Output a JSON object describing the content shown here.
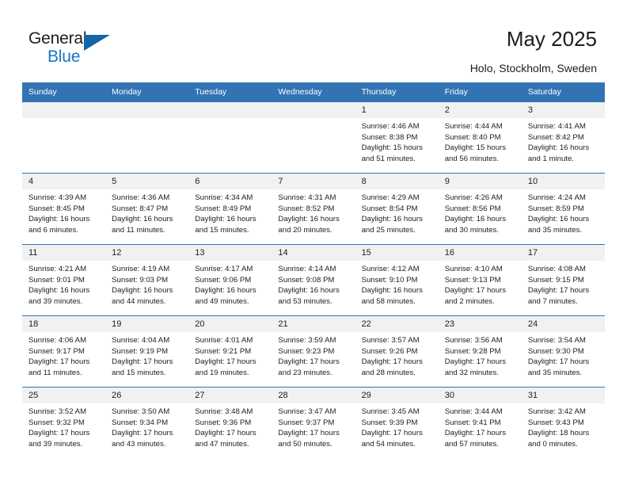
{
  "brand": {
    "name_top": "General",
    "name_bottom": "Blue",
    "accent_color": "#1876c8",
    "triangle_color": "#1464aa"
  },
  "header": {
    "title": "May 2025",
    "subtitle": "Holo, Stockholm, Sweden"
  },
  "calendar": {
    "header_bg": "#3273b4",
    "header_text_color": "#ffffff",
    "daynum_bg": "#f1f1f1",
    "weekdays": [
      "Sunday",
      "Monday",
      "Tuesday",
      "Wednesday",
      "Thursday",
      "Friday",
      "Saturday"
    ],
    "weeks": [
      [
        {
          "day": "",
          "lines": []
        },
        {
          "day": "",
          "lines": []
        },
        {
          "day": "",
          "lines": []
        },
        {
          "day": "",
          "lines": []
        },
        {
          "day": "1",
          "lines": [
            "Sunrise: 4:46 AM",
            "Sunset: 8:38 PM",
            "Daylight: 15 hours",
            "and 51 minutes."
          ]
        },
        {
          "day": "2",
          "lines": [
            "Sunrise: 4:44 AM",
            "Sunset: 8:40 PM",
            "Daylight: 15 hours",
            "and 56 minutes."
          ]
        },
        {
          "day": "3",
          "lines": [
            "Sunrise: 4:41 AM",
            "Sunset: 8:42 PM",
            "Daylight: 16 hours",
            "and 1 minute."
          ]
        }
      ],
      [
        {
          "day": "4",
          "lines": [
            "Sunrise: 4:39 AM",
            "Sunset: 8:45 PM",
            "Daylight: 16 hours",
            "and 6 minutes."
          ]
        },
        {
          "day": "5",
          "lines": [
            "Sunrise: 4:36 AM",
            "Sunset: 8:47 PM",
            "Daylight: 16 hours",
            "and 11 minutes."
          ]
        },
        {
          "day": "6",
          "lines": [
            "Sunrise: 4:34 AM",
            "Sunset: 8:49 PM",
            "Daylight: 16 hours",
            "and 15 minutes."
          ]
        },
        {
          "day": "7",
          "lines": [
            "Sunrise: 4:31 AM",
            "Sunset: 8:52 PM",
            "Daylight: 16 hours",
            "and 20 minutes."
          ]
        },
        {
          "day": "8",
          "lines": [
            "Sunrise: 4:29 AM",
            "Sunset: 8:54 PM",
            "Daylight: 16 hours",
            "and 25 minutes."
          ]
        },
        {
          "day": "9",
          "lines": [
            "Sunrise: 4:26 AM",
            "Sunset: 8:56 PM",
            "Daylight: 16 hours",
            "and 30 minutes."
          ]
        },
        {
          "day": "10",
          "lines": [
            "Sunrise: 4:24 AM",
            "Sunset: 8:59 PM",
            "Daylight: 16 hours",
            "and 35 minutes."
          ]
        }
      ],
      [
        {
          "day": "11",
          "lines": [
            "Sunrise: 4:21 AM",
            "Sunset: 9:01 PM",
            "Daylight: 16 hours",
            "and 39 minutes."
          ]
        },
        {
          "day": "12",
          "lines": [
            "Sunrise: 4:19 AM",
            "Sunset: 9:03 PM",
            "Daylight: 16 hours",
            "and 44 minutes."
          ]
        },
        {
          "day": "13",
          "lines": [
            "Sunrise: 4:17 AM",
            "Sunset: 9:06 PM",
            "Daylight: 16 hours",
            "and 49 minutes."
          ]
        },
        {
          "day": "14",
          "lines": [
            "Sunrise: 4:14 AM",
            "Sunset: 9:08 PM",
            "Daylight: 16 hours",
            "and 53 minutes."
          ]
        },
        {
          "day": "15",
          "lines": [
            "Sunrise: 4:12 AM",
            "Sunset: 9:10 PM",
            "Daylight: 16 hours",
            "and 58 minutes."
          ]
        },
        {
          "day": "16",
          "lines": [
            "Sunrise: 4:10 AM",
            "Sunset: 9:13 PM",
            "Daylight: 17 hours",
            "and 2 minutes."
          ]
        },
        {
          "day": "17",
          "lines": [
            "Sunrise: 4:08 AM",
            "Sunset: 9:15 PM",
            "Daylight: 17 hours",
            "and 7 minutes."
          ]
        }
      ],
      [
        {
          "day": "18",
          "lines": [
            "Sunrise: 4:06 AM",
            "Sunset: 9:17 PM",
            "Daylight: 17 hours",
            "and 11 minutes."
          ]
        },
        {
          "day": "19",
          "lines": [
            "Sunrise: 4:04 AM",
            "Sunset: 9:19 PM",
            "Daylight: 17 hours",
            "and 15 minutes."
          ]
        },
        {
          "day": "20",
          "lines": [
            "Sunrise: 4:01 AM",
            "Sunset: 9:21 PM",
            "Daylight: 17 hours",
            "and 19 minutes."
          ]
        },
        {
          "day": "21",
          "lines": [
            "Sunrise: 3:59 AM",
            "Sunset: 9:23 PM",
            "Daylight: 17 hours",
            "and 23 minutes."
          ]
        },
        {
          "day": "22",
          "lines": [
            "Sunrise: 3:57 AM",
            "Sunset: 9:26 PM",
            "Daylight: 17 hours",
            "and 28 minutes."
          ]
        },
        {
          "day": "23",
          "lines": [
            "Sunrise: 3:56 AM",
            "Sunset: 9:28 PM",
            "Daylight: 17 hours",
            "and 32 minutes."
          ]
        },
        {
          "day": "24",
          "lines": [
            "Sunrise: 3:54 AM",
            "Sunset: 9:30 PM",
            "Daylight: 17 hours",
            "and 35 minutes."
          ]
        }
      ],
      [
        {
          "day": "25",
          "lines": [
            "Sunrise: 3:52 AM",
            "Sunset: 9:32 PM",
            "Daylight: 17 hours",
            "and 39 minutes."
          ]
        },
        {
          "day": "26",
          "lines": [
            "Sunrise: 3:50 AM",
            "Sunset: 9:34 PM",
            "Daylight: 17 hours",
            "and 43 minutes."
          ]
        },
        {
          "day": "27",
          "lines": [
            "Sunrise: 3:48 AM",
            "Sunset: 9:36 PM",
            "Daylight: 17 hours",
            "and 47 minutes."
          ]
        },
        {
          "day": "28",
          "lines": [
            "Sunrise: 3:47 AM",
            "Sunset: 9:37 PM",
            "Daylight: 17 hours",
            "and 50 minutes."
          ]
        },
        {
          "day": "29",
          "lines": [
            "Sunrise: 3:45 AM",
            "Sunset: 9:39 PM",
            "Daylight: 17 hours",
            "and 54 minutes."
          ]
        },
        {
          "day": "30",
          "lines": [
            "Sunrise: 3:44 AM",
            "Sunset: 9:41 PM",
            "Daylight: 17 hours",
            "and 57 minutes."
          ]
        },
        {
          "day": "31",
          "lines": [
            "Sunrise: 3:42 AM",
            "Sunset: 9:43 PM",
            "Daylight: 18 hours",
            "and 0 minutes."
          ]
        }
      ]
    ]
  }
}
